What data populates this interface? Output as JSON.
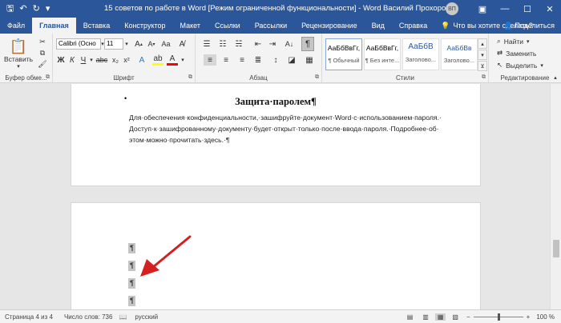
{
  "window": {
    "title": "15 советов по работе в Word [Режим ограниченной функциональности]  -  Word",
    "user": "Василий Прохоров",
    "avatar_initials": "ВП",
    "quick_access_icons": [
      "save-icon",
      "undo-icon",
      "redo-icon",
      "customize-icon"
    ],
    "controls": [
      "ribbon-display-icon",
      "minimize-icon",
      "maximize-icon",
      "close-icon"
    ]
  },
  "tabs": [
    {
      "label": "Файл"
    },
    {
      "label": "Главная",
      "active": true
    },
    {
      "label": "Вставка"
    },
    {
      "label": "Конструктор"
    },
    {
      "label": "Макет"
    },
    {
      "label": "Ссылки"
    },
    {
      "label": "Рассылки"
    },
    {
      "label": "Рецензирование"
    },
    {
      "label": "Вид"
    },
    {
      "label": "Справка"
    }
  ],
  "tellme": "Что вы хотите сделать?",
  "share": "Поделиться",
  "ribbon": {
    "clipboard": {
      "paste_label": "Вставить",
      "group_label": "Буфер обме..."
    },
    "font": {
      "font_name": "Calibri (Осно",
      "font_size": "11",
      "group_label": "Шрифт"
    },
    "paragraph": {
      "group_label": "Абзац"
    },
    "styles": {
      "group_label": "Стили",
      "items": [
        {
          "preview": "АаБбВвГг,",
          "name": "¶ Обычный"
        },
        {
          "preview": "АаБбВвГг,",
          "name": "¶ Без инте..."
        },
        {
          "preview": "АаБбВ",
          "name": "Заголово..."
        },
        {
          "preview": "АаБбВв",
          "name": "Заголово..."
        }
      ]
    },
    "editing": {
      "find": "Найти",
      "replace": "Заменить",
      "select": "Выделить",
      "group_label": "Редактирование"
    }
  },
  "document": {
    "heading": "Защита·паролем¶",
    "lines": [
      "Для·обеспечения·конфиденциальности,·зашифруйте·документ·Word·с·использованием·пароля.·",
      "Доступ·к·зашифрованному·документу·будет·открыт·только·после·ввода·пароля.·Подробнее·об·",
      "этом·можно·прочитать·здесь.·¶"
    ],
    "pilcrows": [
      "¶",
      "¶",
      "¶",
      "¶"
    ]
  },
  "status": {
    "page": "Страница 4 из 4",
    "words": "Число слов: 736",
    "language": "русский",
    "zoom": "100 %"
  },
  "colors": {
    "brand": "#2b579a",
    "highlight": "#ffff00",
    "font_color": "#ff0000",
    "arrow": "#d42020"
  }
}
